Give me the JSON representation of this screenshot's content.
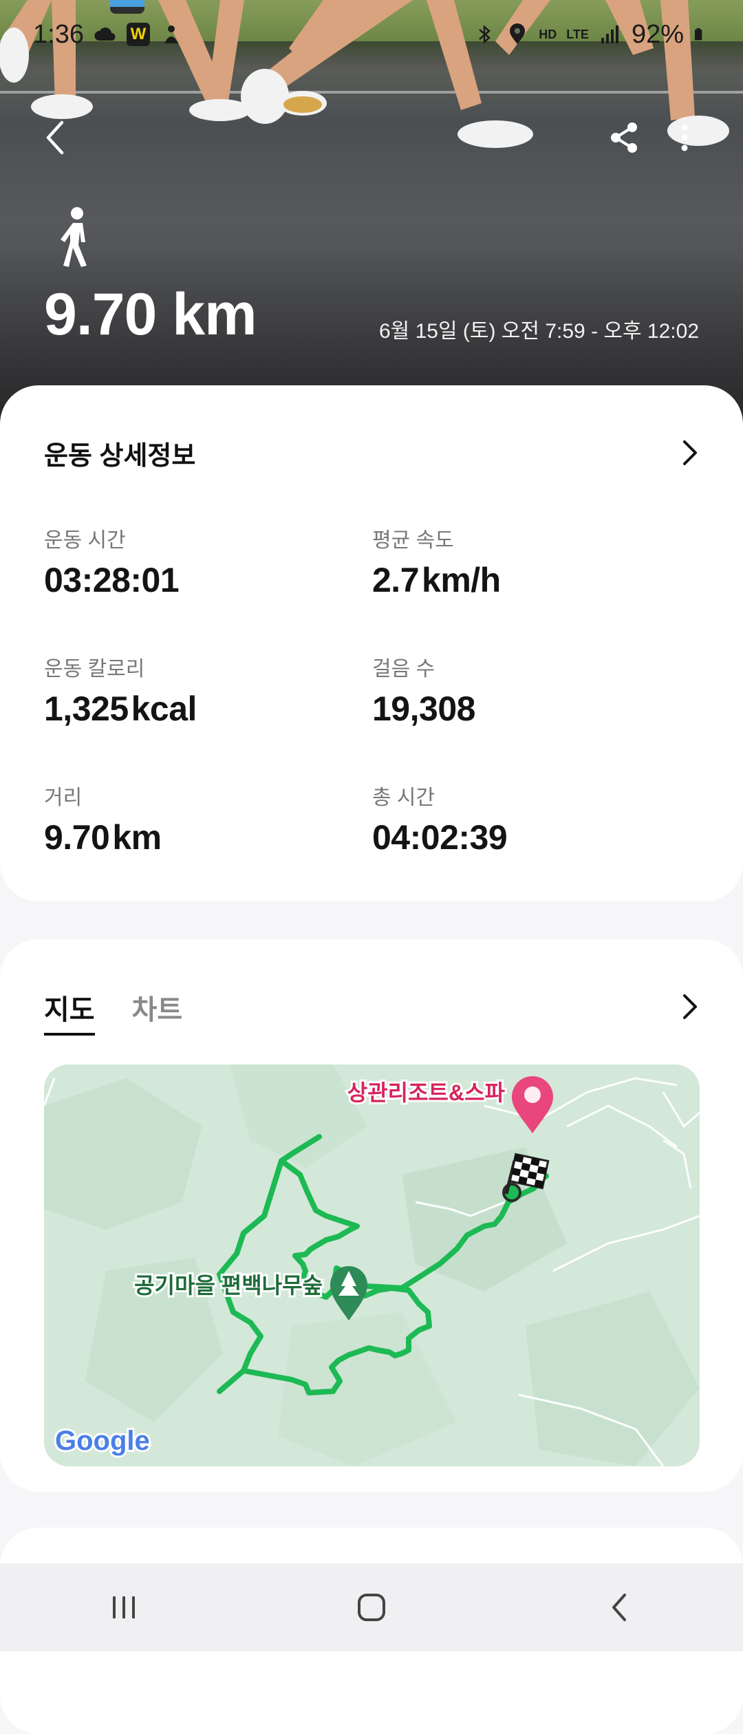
{
  "status_bar": {
    "time": "1:36",
    "network": "LTE",
    "hd_label": "HD",
    "battery": "92%"
  },
  "hero": {
    "distance": "9.70 km",
    "date_range": "6월 15일 (토) 오전 7:59 - 오후 12:02"
  },
  "details": {
    "title": "운동 상세정보",
    "stats": [
      {
        "label": "운동 시간",
        "value": "03:28:01",
        "unit": ""
      },
      {
        "label": "평균 속도",
        "value": "2.7",
        "unit": "km/h"
      },
      {
        "label": "운동 칼로리",
        "value": "1,325",
        "unit": "kcal"
      },
      {
        "label": "걸음 수",
        "value": "19,308",
        "unit": ""
      },
      {
        "label": "거리",
        "value": "9.70",
        "unit": "km"
      },
      {
        "label": "총 시간",
        "value": "04:02:39",
        "unit": ""
      }
    ]
  },
  "map_card": {
    "tabs": [
      {
        "label": "지도",
        "active": true
      },
      {
        "label": "차트",
        "active": false
      }
    ],
    "places": {
      "resort": "상관리조트&스파",
      "forest": "공기마을 편백나무숲"
    },
    "map_logo": "Google",
    "route_color": "#1db954"
  },
  "colors": {
    "accent_route": "#1db954",
    "pin_pink": "#e8467c",
    "pin_green": "#2e8b57"
  }
}
